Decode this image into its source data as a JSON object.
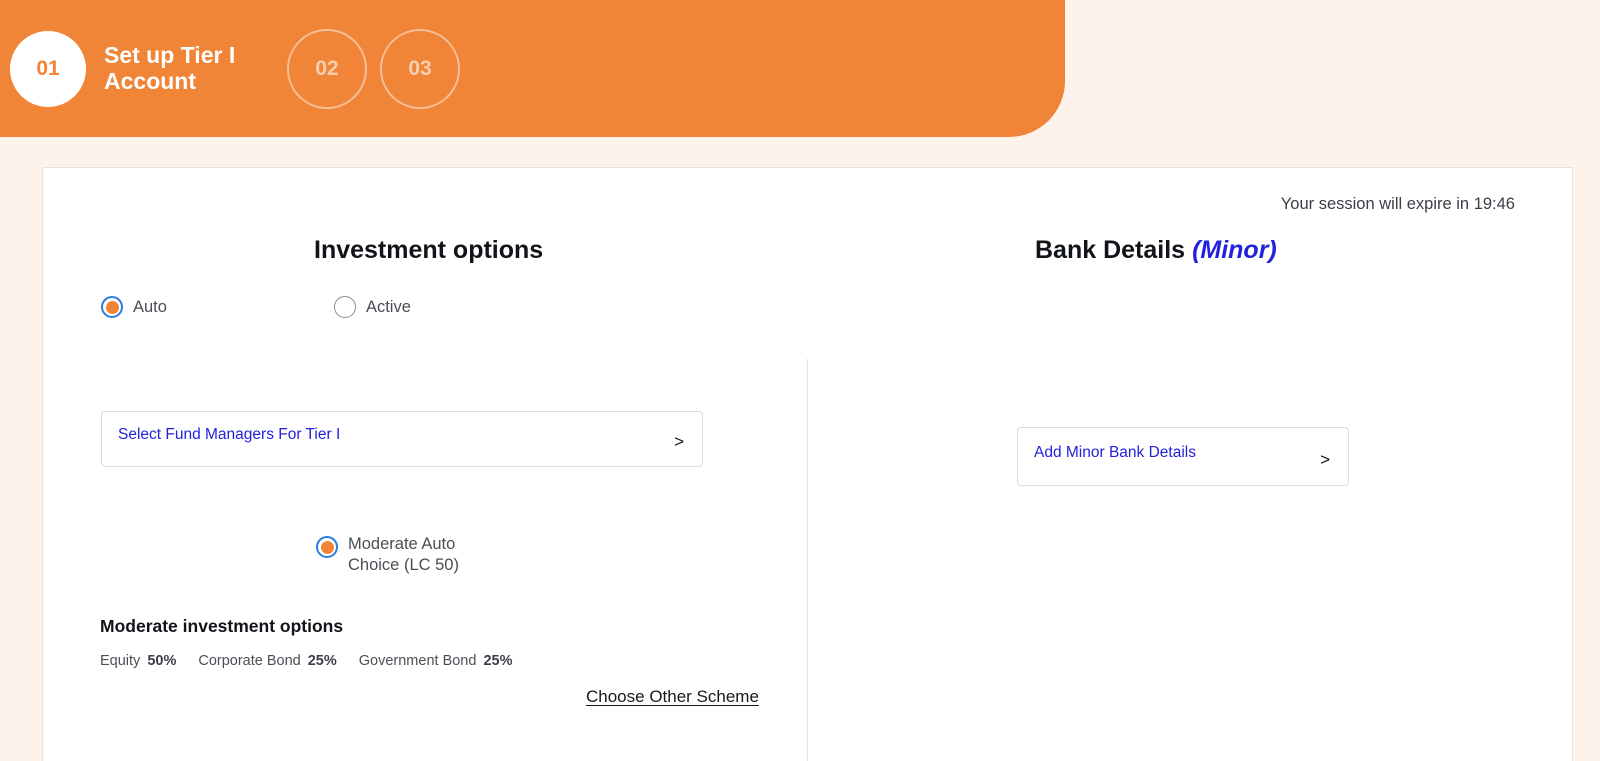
{
  "theme": {
    "accent_orange": "#f08437",
    "page_background": "#fdf3ea",
    "link_blue": "#2222dd",
    "radio_ring_blue": "#2a7de1",
    "card_background": "#ffffff"
  },
  "stepper": {
    "steps": [
      {
        "number": "01",
        "label": "Set up Tier I Account",
        "state": "active"
      },
      {
        "number": "02",
        "label": "",
        "state": "inactive"
      },
      {
        "number": "03",
        "label": "",
        "state": "inactive"
      }
    ]
  },
  "session": {
    "notice": "Your session will expire in 19:46"
  },
  "investment": {
    "title": "Investment options",
    "mode_options": [
      {
        "label": "Auto",
        "selected": true
      },
      {
        "label": "Active",
        "selected": false
      }
    ],
    "fund_manager_link": {
      "label": "Select Fund Managers For Tier I",
      "chevron": "chevron-right-icon",
      "chevron_glyph": ">"
    },
    "scheme": {
      "label_line1": "Moderate Auto",
      "label_line2": "Choice (LC 50)",
      "selected": true
    },
    "allocation_heading": "Moderate investment options",
    "allocations": [
      {
        "name": "Equity",
        "percent": "50%"
      },
      {
        "name": "Corporate Bond",
        "percent": "25%"
      },
      {
        "name": "Government Bond",
        "percent": "25%"
      }
    ],
    "other_scheme_link": "Choose Other Scheme"
  },
  "bank": {
    "title": "Bank Details",
    "title_tag": "(Minor)",
    "add_link": {
      "label": "Add Minor Bank Details",
      "chevron": "chevron-right-icon",
      "chevron_glyph": ">"
    }
  }
}
